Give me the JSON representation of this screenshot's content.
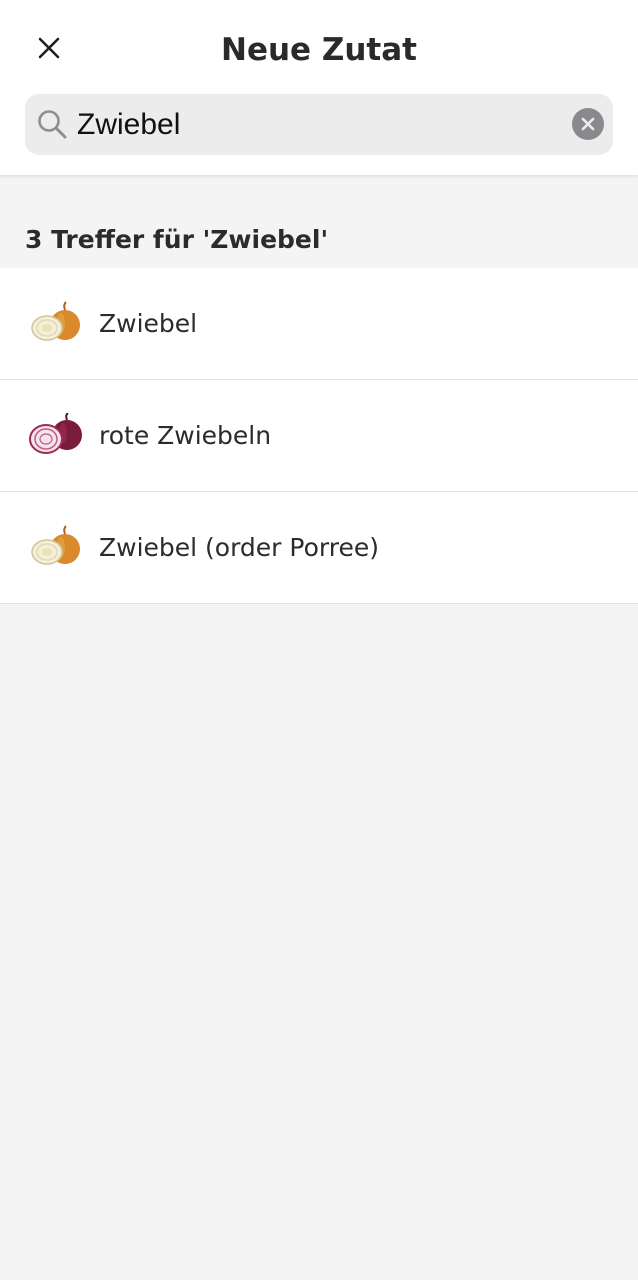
{
  "header": {
    "title": "Neue Zutat",
    "close_icon": "close-icon"
  },
  "search": {
    "value": "Zwiebel",
    "search_icon": "search-icon",
    "clear_icon": "clear-icon"
  },
  "results": {
    "heading": "3 Treffer für 'Zwiebel'",
    "items": [
      {
        "label": "Zwiebel",
        "icon": "yellow-onion-icon"
      },
      {
        "label": "rote Zwiebeln",
        "icon": "red-onion-icon"
      },
      {
        "label": "Zwiebel (order Porree)",
        "icon": "yellow-onion-icon"
      }
    ]
  },
  "colors": {
    "background": "#f4f4f4",
    "surface": "#ffffff",
    "search_field": "#ececec",
    "text": "#2b2b2b",
    "clear_button": "#8a8a8e"
  }
}
